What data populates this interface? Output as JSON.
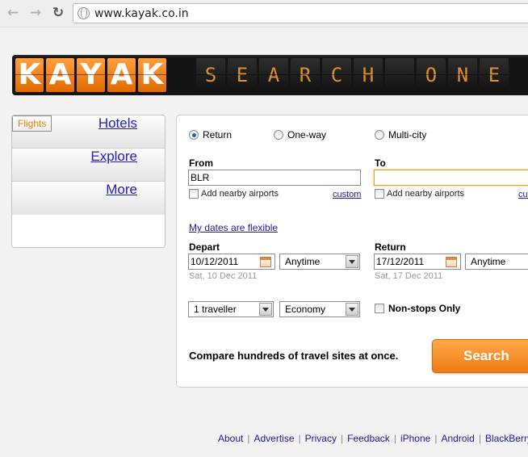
{
  "browser": {
    "back_icon": "back-arrow-icon",
    "forward_icon": "forward-arrow-icon",
    "reload_icon": "reload-icon",
    "url": "www.kayak.co.in"
  },
  "banner": {
    "logo_letters": [
      "K",
      "A",
      "Y",
      "A",
      "K"
    ],
    "board_letters": [
      "S",
      "E",
      "A",
      "R",
      "C",
      "H",
      "",
      "O",
      "N",
      "E"
    ]
  },
  "nav": {
    "items": [
      {
        "label": "Flights",
        "selected": true
      },
      {
        "label": "Hotels",
        "selected": false
      },
      {
        "label": "Explore",
        "selected": false
      },
      {
        "label": "More",
        "selected": false
      }
    ]
  },
  "trip_type": {
    "options": [
      "Return",
      "One-way",
      "Multi-city"
    ],
    "selected": "Return"
  },
  "from": {
    "label": "From",
    "value": "BLR",
    "nearby": "Add nearby airports",
    "custom": "custom"
  },
  "to": {
    "label": "To",
    "value": "",
    "nearby": "Add nearby airports",
    "custom": "custom"
  },
  "flexible_link": "My dates are flexible",
  "depart": {
    "label": "Depart",
    "date": "10/12/2011",
    "time": "Anytime",
    "hint": "Sat, 10 Dec 2011"
  },
  "return_date": {
    "label": "Return",
    "date": "17/12/2011",
    "time": "Anytime",
    "hint": "Sat, 17 Dec 2011"
  },
  "travellers": "1 traveller",
  "cabin": "Economy",
  "nonstop": "Non-stops Only",
  "compare_text": "Compare hundreds of travel sites at once.",
  "search_button": "Search",
  "footer": [
    "About",
    "Advertise",
    "Privacy",
    "Feedback",
    "iPhone",
    "Android",
    "BlackBerry"
  ],
  "colors": {
    "accent": "#ee7a12",
    "link": "#1a1aa6",
    "selected_nav": "#e97e0a"
  }
}
